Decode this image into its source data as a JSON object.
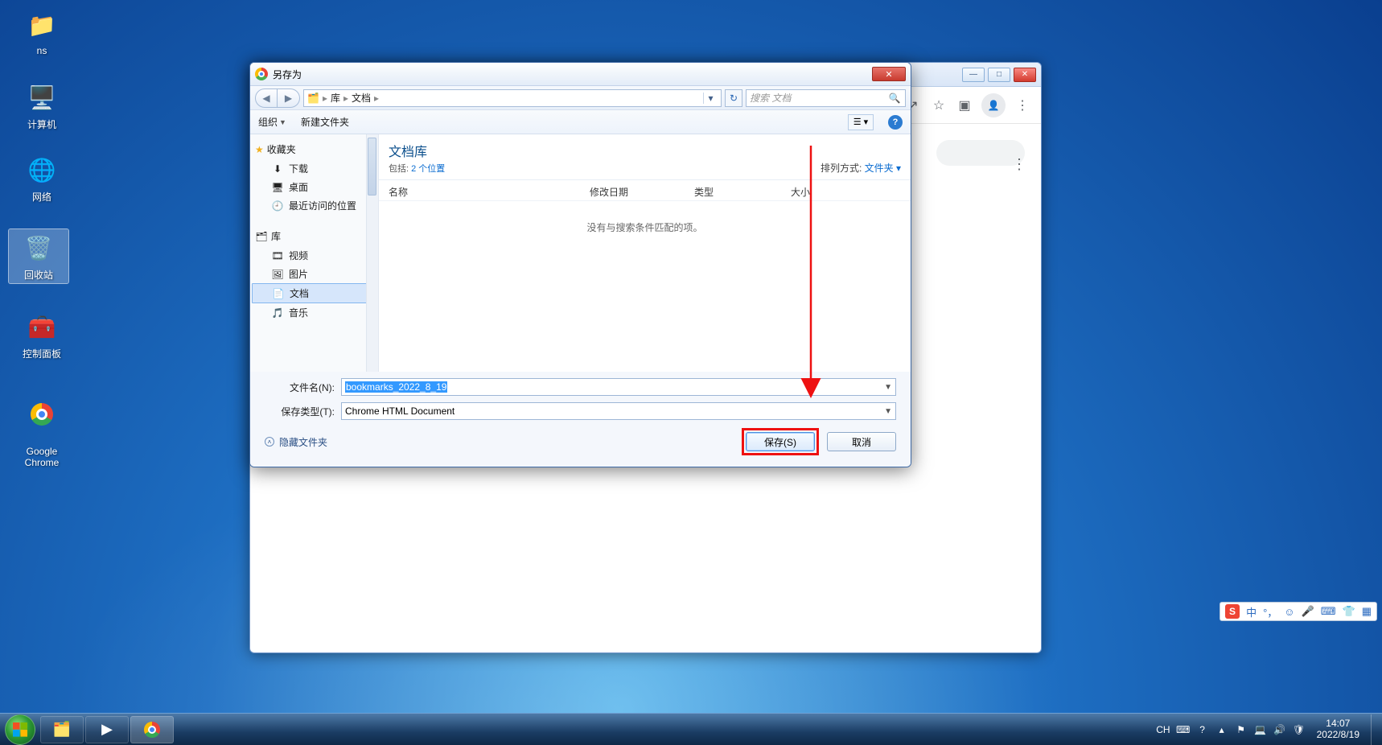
{
  "desktop_icons": {
    "ns": {
      "label": "ns"
    },
    "computer": {
      "label": "计算机"
    },
    "network": {
      "label": "网络"
    },
    "recycle": {
      "label": "回收站"
    },
    "control": {
      "label": "控制面板"
    },
    "chrome": {
      "label": "Google\nChrome"
    }
  },
  "chrome": {
    "win_buttons": {
      "min": "—",
      "max": "□",
      "close": "✕"
    }
  },
  "saveas": {
    "title": "另存为",
    "breadcrumb": {
      "root": "库",
      "folder": "文档"
    },
    "search_placeholder": "搜索 文档",
    "toolbar": {
      "organize": "组织",
      "new_folder": "新建文件夹"
    },
    "sidebar": {
      "favorites": {
        "header": "收藏夹",
        "items": [
          "下载",
          "桌面",
          "最近访问的位置"
        ]
      },
      "libraries": {
        "header": "库",
        "items": [
          "视频",
          "图片",
          "文档",
          "音乐"
        ]
      }
    },
    "main": {
      "title": "文档库",
      "subtitle_prefix": "包括:",
      "subtitle_link": "2 个位置",
      "arrange_label": "排列方式:",
      "arrange_value": "文件夹",
      "columns": {
        "name": "名称",
        "date": "修改日期",
        "type": "类型",
        "size": "大小"
      },
      "empty": "没有与搜索条件匹配的项。"
    },
    "fields": {
      "filename_label": "文件名(N):",
      "filename_value": "bookmarks_2022_8_19",
      "filetype_label": "保存类型(T):",
      "filetype_value": "Chrome HTML Document"
    },
    "footer": {
      "hide_folders": "隐藏文件夹",
      "save": "保存(S)",
      "cancel": "取消"
    }
  },
  "ime": {
    "lang": "中"
  },
  "tray": {
    "lang": "CH",
    "time": "14:07",
    "date": "2022/8/19"
  }
}
